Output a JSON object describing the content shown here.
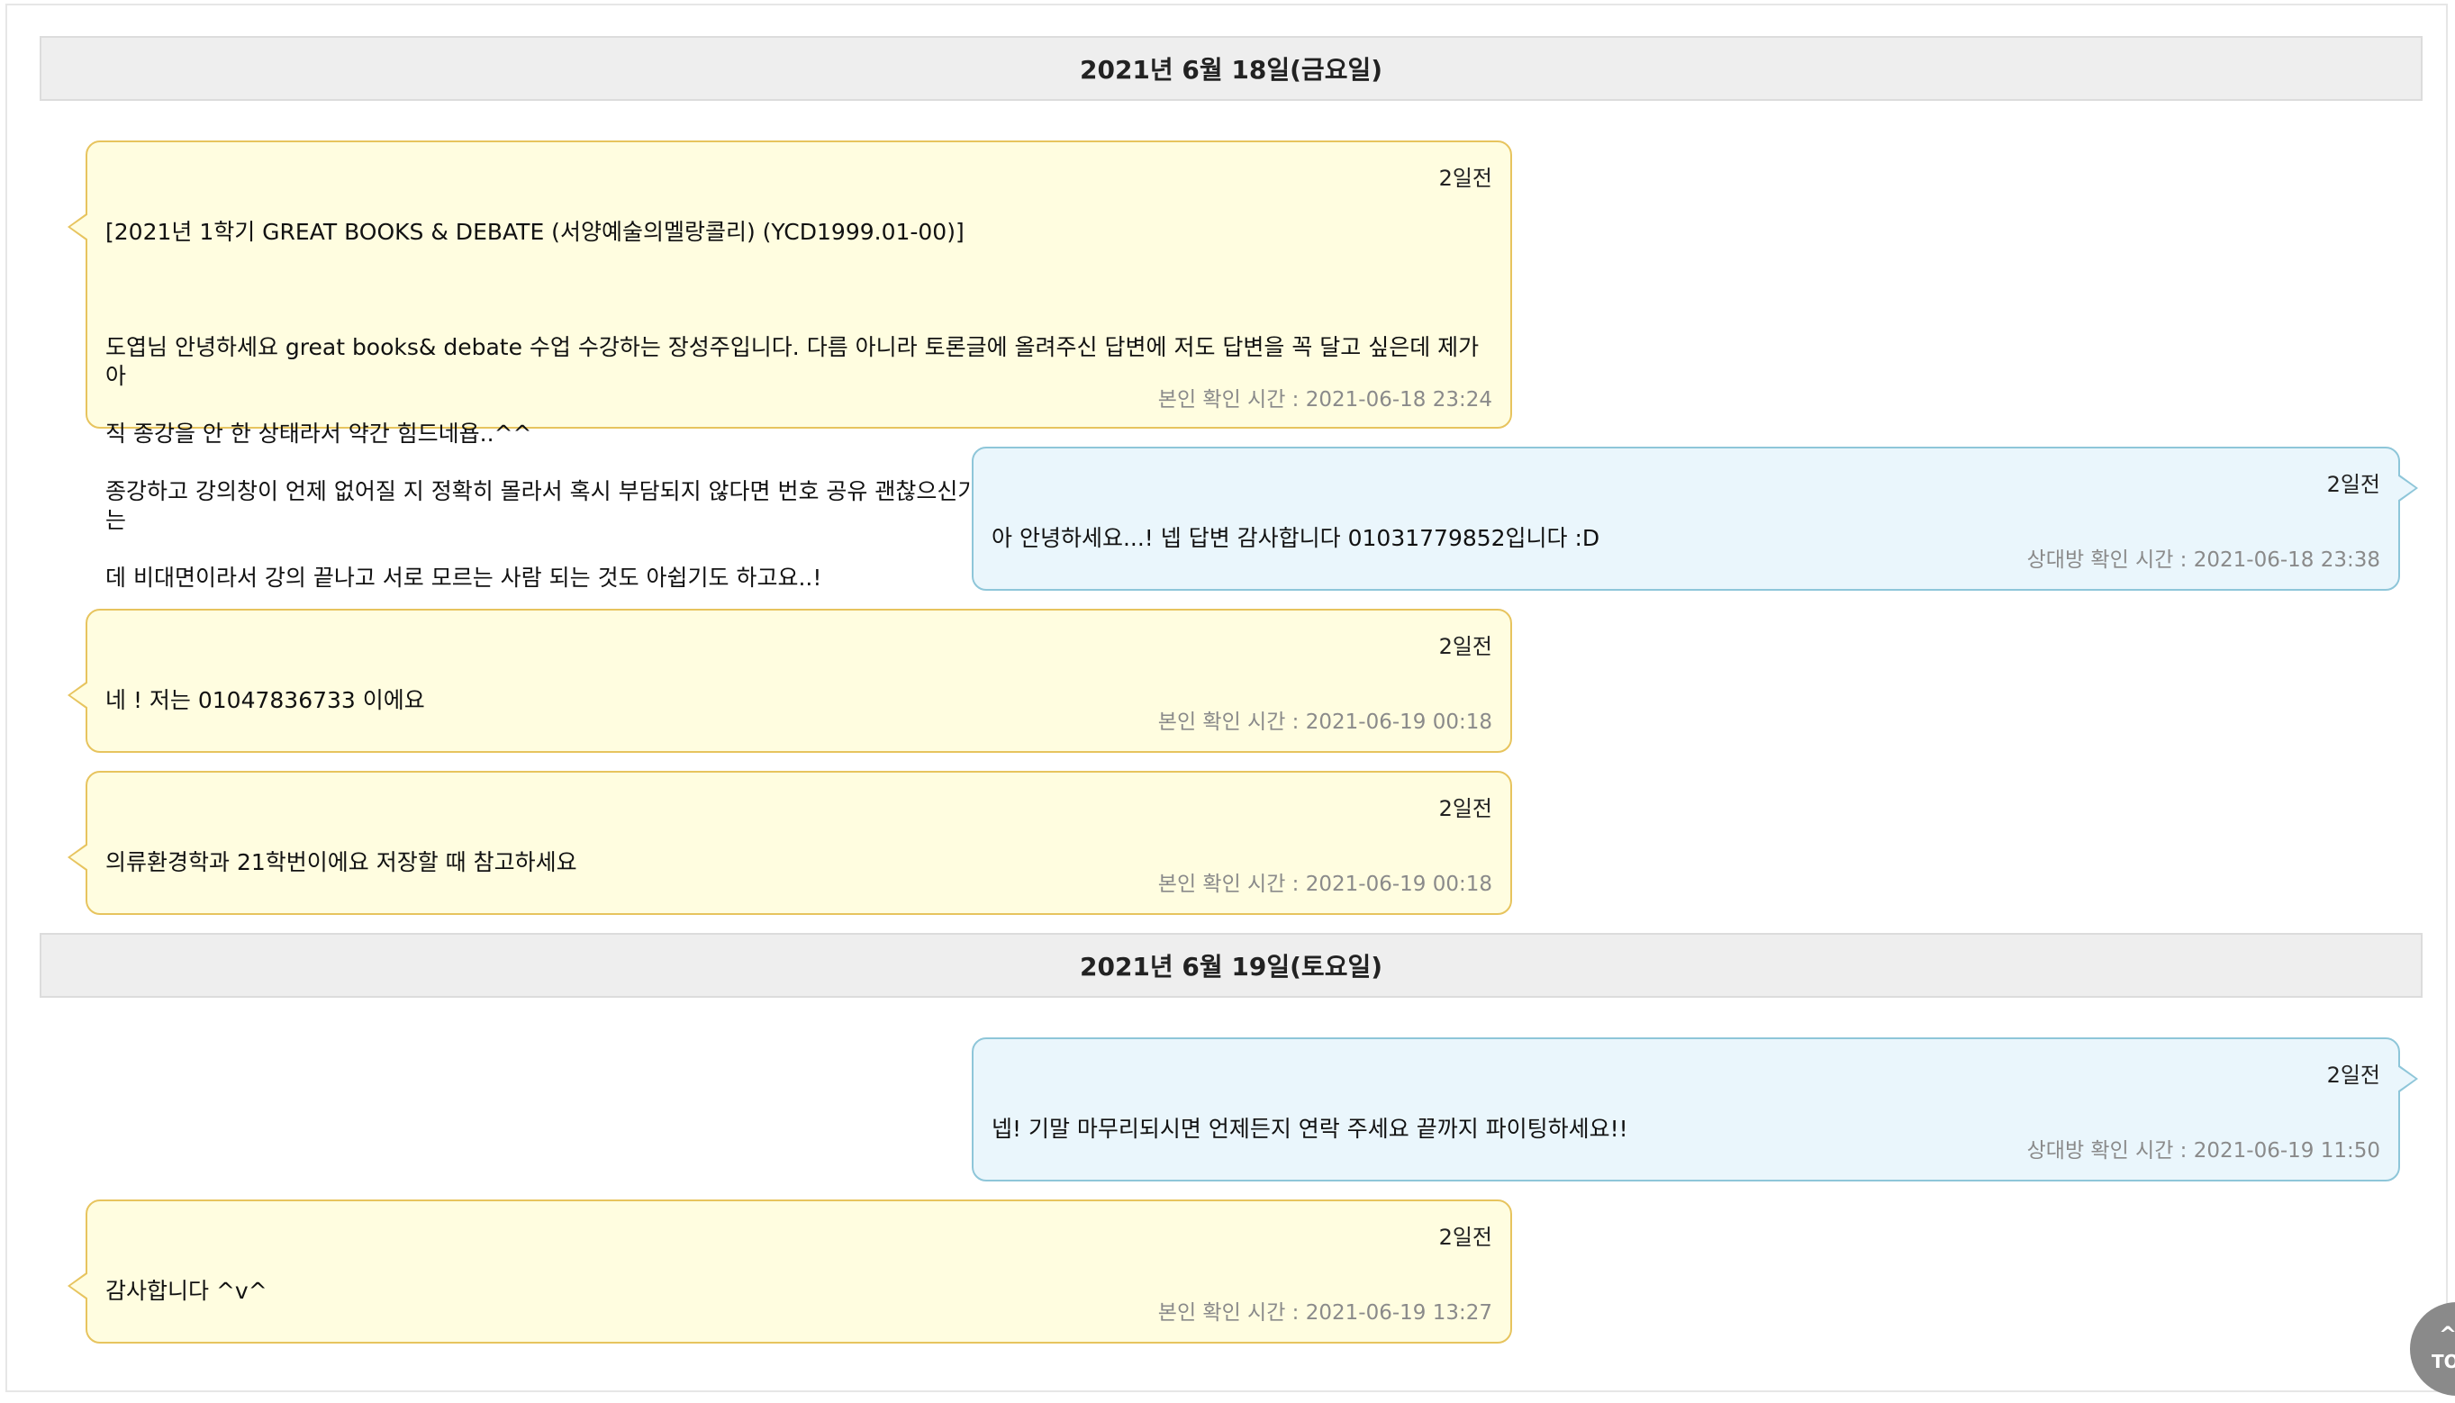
{
  "dates": [
    "2021년 6월 18일(금요일)",
    "2021년 6월 19일(토요일)"
  ],
  "messages": [
    {
      "ago": "2일전",
      "lines": [
        "[2021년 1학기 GREAT BOOKS & DEBATE (서양예술의멜랑콜리) (YCD1999.01-00)]",
        "",
        "도엽님 안녕하세요 great books& debate 수업 수강하는 장성주입니다. 다름 아니라 토론글에 올려주신 답변에 저도 답변을 꼭 달고 싶은데 제가 아",
        "직 종강을 안 한 상태라서 약간 힘드네욥..^^",
        "종강하고 강의창이 언제 없어질 지 정확히 몰라서 혹시 부담되지 않다면 번호 공유 괜찮으신가요? 한 학기 동안 같이 수업 참여하고 토론도 몇 번 했는",
        "데 비대면이라서 강의 끝나고 서로 모르는 사람 되는 것도 아쉽기도 하고요..!"
      ],
      "read": "본인 확인 시간 : 2021-06-18 23:24"
    },
    {
      "ago": "2일전",
      "lines": [
        "아 안녕하세요...! 넵 답변 감사합니다 01031779852입니다 :D"
      ],
      "read": "상대방 확인 시간 : 2021-06-18 23:38"
    },
    {
      "ago": "2일전",
      "lines": [
        "네 ! 저는 01047836733 이에요"
      ],
      "read": "본인 확인 시간 : 2021-06-19 00:18"
    },
    {
      "ago": "2일전",
      "lines": [
        "의류환경학과 21학번이에요 저장할 때 참고하세요"
      ],
      "read": "본인 확인 시간 : 2021-06-19 00:18"
    },
    {
      "ago": "2일전",
      "lines": [
        "넵! 기말 마무리되시면 언제든지 연락 주세요 끝까지 파이팅하세요!!"
      ],
      "read": "상대방 확인 시간 : 2021-06-19 11:50"
    },
    {
      "ago": "2일전",
      "lines": [
        "감사합니다 ^v^"
      ],
      "read": "본인 확인 시간 : 2021-06-19 13:27"
    }
  ],
  "top_button": {
    "label": "TO",
    "icon": "chevron-up-icon"
  }
}
